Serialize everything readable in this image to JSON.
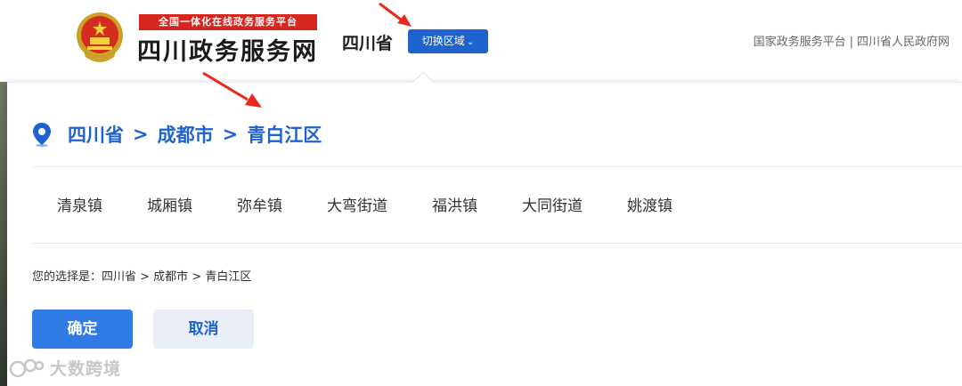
{
  "header": {
    "banner_text": "全国一体化在线政务服务平台",
    "site_title": "四川政务服务网",
    "current_region": "四川省",
    "switch_button_label": "切换区域",
    "top_links": [
      "国家政务服务平台",
      "四川省人民政府网"
    ],
    "top_links_separator": "|"
  },
  "panel": {
    "breadcrumb": [
      "四川省",
      "成都市",
      "青白江区"
    ],
    "breadcrumb_separator": ">",
    "towns": [
      "清泉镇",
      "城厢镇",
      "弥牟镇",
      "大弯街道",
      "福洪镇",
      "大同街道",
      "姚渡镇"
    ],
    "selection_label": "您的选择是：",
    "selection_value": "四川省 > 成都市 > 青白江区",
    "confirm_label": "确定",
    "cancel_label": "取消"
  },
  "watermark": {
    "text": "大数跨境"
  },
  "colors": {
    "primary": "#1f63cf",
    "confirm": "#2f7ae5",
    "banner_red": "#d7261e",
    "annotation_red": "#e8291c"
  },
  "icons": {
    "emblem": "national-emblem-icon",
    "location": "map-pin-icon",
    "chevron": "chevron-down-icon"
  }
}
